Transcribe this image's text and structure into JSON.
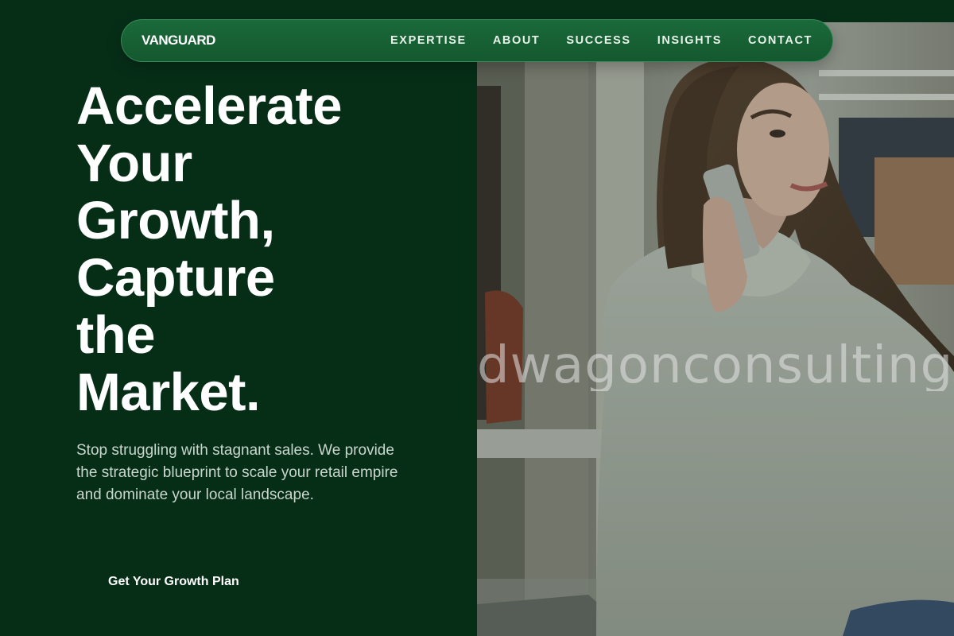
{
  "nav": {
    "brand": "VANGUARD",
    "links": [
      "EXPERTISE",
      "ABOUT",
      "SUCCESS",
      "INSIGHTS",
      "CONTACT"
    ]
  },
  "hero": {
    "headline_lines": [
      "Accelerate",
      "Your",
      "Growth,",
      "Capture",
      "the",
      "Market."
    ],
    "subtext": "Stop struggling with stagnant sales. We provide the strategic blueprint to scale your retail empire and dominate your local landscape.",
    "cta_label": "Get Your Growth Plan",
    "watermark": "dwagonconsulting"
  },
  "colors": {
    "background": "#062e17",
    "nav_pill": "#14582f",
    "text": "#ffffff",
    "subtext": "#c9d6cd"
  }
}
